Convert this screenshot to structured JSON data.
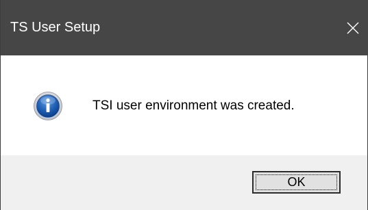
{
  "window": {
    "title": "TS User Setup",
    "close_icon": "close-icon"
  },
  "dialog": {
    "icon": "info-icon",
    "message": "TSI user environment was created."
  },
  "buttons": {
    "ok_label": "OK"
  },
  "colors": {
    "titlebar": "#464646",
    "title_text": "#ffffff",
    "content_bg": "#ffffff",
    "footer_bg": "#f0f0f0",
    "button_bg": "#e1e1e1",
    "icon_blue": "#1e5fb4"
  }
}
